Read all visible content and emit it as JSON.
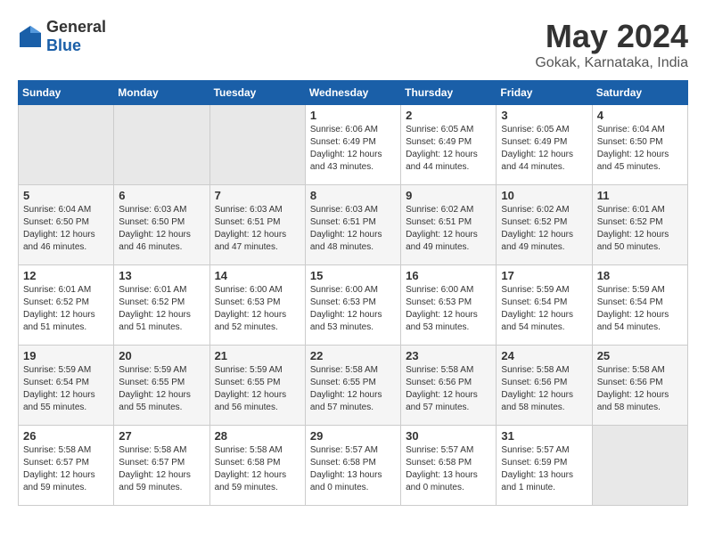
{
  "header": {
    "logo_general": "General",
    "logo_blue": "Blue",
    "month": "May 2024",
    "location": "Gokak, Karnataka, India"
  },
  "weekdays": [
    "Sunday",
    "Monday",
    "Tuesday",
    "Wednesday",
    "Thursday",
    "Friday",
    "Saturday"
  ],
  "weeks": [
    [
      {
        "day": "",
        "sunrise": "",
        "sunset": "",
        "daylight": "",
        "empty": true
      },
      {
        "day": "",
        "sunrise": "",
        "sunset": "",
        "daylight": "",
        "empty": true
      },
      {
        "day": "",
        "sunrise": "",
        "sunset": "",
        "daylight": "",
        "empty": true
      },
      {
        "day": "1",
        "sunrise": "Sunrise: 6:06 AM",
        "sunset": "Sunset: 6:49 PM",
        "daylight": "Daylight: 12 hours and 43 minutes."
      },
      {
        "day": "2",
        "sunrise": "Sunrise: 6:05 AM",
        "sunset": "Sunset: 6:49 PM",
        "daylight": "Daylight: 12 hours and 44 minutes."
      },
      {
        "day": "3",
        "sunrise": "Sunrise: 6:05 AM",
        "sunset": "Sunset: 6:49 PM",
        "daylight": "Daylight: 12 hours and 44 minutes."
      },
      {
        "day": "4",
        "sunrise": "Sunrise: 6:04 AM",
        "sunset": "Sunset: 6:50 PM",
        "daylight": "Daylight: 12 hours and 45 minutes."
      }
    ],
    [
      {
        "day": "5",
        "sunrise": "Sunrise: 6:04 AM",
        "sunset": "Sunset: 6:50 PM",
        "daylight": "Daylight: 12 hours and 46 minutes."
      },
      {
        "day": "6",
        "sunrise": "Sunrise: 6:03 AM",
        "sunset": "Sunset: 6:50 PM",
        "daylight": "Daylight: 12 hours and 46 minutes."
      },
      {
        "day": "7",
        "sunrise": "Sunrise: 6:03 AM",
        "sunset": "Sunset: 6:51 PM",
        "daylight": "Daylight: 12 hours and 47 minutes."
      },
      {
        "day": "8",
        "sunrise": "Sunrise: 6:03 AM",
        "sunset": "Sunset: 6:51 PM",
        "daylight": "Daylight: 12 hours and 48 minutes."
      },
      {
        "day": "9",
        "sunrise": "Sunrise: 6:02 AM",
        "sunset": "Sunset: 6:51 PM",
        "daylight": "Daylight: 12 hours and 49 minutes."
      },
      {
        "day": "10",
        "sunrise": "Sunrise: 6:02 AM",
        "sunset": "Sunset: 6:52 PM",
        "daylight": "Daylight: 12 hours and 49 minutes."
      },
      {
        "day": "11",
        "sunrise": "Sunrise: 6:01 AM",
        "sunset": "Sunset: 6:52 PM",
        "daylight": "Daylight: 12 hours and 50 minutes."
      }
    ],
    [
      {
        "day": "12",
        "sunrise": "Sunrise: 6:01 AM",
        "sunset": "Sunset: 6:52 PM",
        "daylight": "Daylight: 12 hours and 51 minutes."
      },
      {
        "day": "13",
        "sunrise": "Sunrise: 6:01 AM",
        "sunset": "Sunset: 6:52 PM",
        "daylight": "Daylight: 12 hours and 51 minutes."
      },
      {
        "day": "14",
        "sunrise": "Sunrise: 6:00 AM",
        "sunset": "Sunset: 6:53 PM",
        "daylight": "Daylight: 12 hours and 52 minutes."
      },
      {
        "day": "15",
        "sunrise": "Sunrise: 6:00 AM",
        "sunset": "Sunset: 6:53 PM",
        "daylight": "Daylight: 12 hours and 53 minutes."
      },
      {
        "day": "16",
        "sunrise": "Sunrise: 6:00 AM",
        "sunset": "Sunset: 6:53 PM",
        "daylight": "Daylight: 12 hours and 53 minutes."
      },
      {
        "day": "17",
        "sunrise": "Sunrise: 5:59 AM",
        "sunset": "Sunset: 6:54 PM",
        "daylight": "Daylight: 12 hours and 54 minutes."
      },
      {
        "day": "18",
        "sunrise": "Sunrise: 5:59 AM",
        "sunset": "Sunset: 6:54 PM",
        "daylight": "Daylight: 12 hours and 54 minutes."
      }
    ],
    [
      {
        "day": "19",
        "sunrise": "Sunrise: 5:59 AM",
        "sunset": "Sunset: 6:54 PM",
        "daylight": "Daylight: 12 hours and 55 minutes."
      },
      {
        "day": "20",
        "sunrise": "Sunrise: 5:59 AM",
        "sunset": "Sunset: 6:55 PM",
        "daylight": "Daylight: 12 hours and 55 minutes."
      },
      {
        "day": "21",
        "sunrise": "Sunrise: 5:59 AM",
        "sunset": "Sunset: 6:55 PM",
        "daylight": "Daylight: 12 hours and 56 minutes."
      },
      {
        "day": "22",
        "sunrise": "Sunrise: 5:58 AM",
        "sunset": "Sunset: 6:55 PM",
        "daylight": "Daylight: 12 hours and 57 minutes."
      },
      {
        "day": "23",
        "sunrise": "Sunrise: 5:58 AM",
        "sunset": "Sunset: 6:56 PM",
        "daylight": "Daylight: 12 hours and 57 minutes."
      },
      {
        "day": "24",
        "sunrise": "Sunrise: 5:58 AM",
        "sunset": "Sunset: 6:56 PM",
        "daylight": "Daylight: 12 hours and 58 minutes."
      },
      {
        "day": "25",
        "sunrise": "Sunrise: 5:58 AM",
        "sunset": "Sunset: 6:56 PM",
        "daylight": "Daylight: 12 hours and 58 minutes."
      }
    ],
    [
      {
        "day": "26",
        "sunrise": "Sunrise: 5:58 AM",
        "sunset": "Sunset: 6:57 PM",
        "daylight": "Daylight: 12 hours and 59 minutes."
      },
      {
        "day": "27",
        "sunrise": "Sunrise: 5:58 AM",
        "sunset": "Sunset: 6:57 PM",
        "daylight": "Daylight: 12 hours and 59 minutes."
      },
      {
        "day": "28",
        "sunrise": "Sunrise: 5:58 AM",
        "sunset": "Sunset: 6:58 PM",
        "daylight": "Daylight: 12 hours and 59 minutes."
      },
      {
        "day": "29",
        "sunrise": "Sunrise: 5:57 AM",
        "sunset": "Sunset: 6:58 PM",
        "daylight": "Daylight: 13 hours and 0 minutes."
      },
      {
        "day": "30",
        "sunrise": "Sunrise: 5:57 AM",
        "sunset": "Sunset: 6:58 PM",
        "daylight": "Daylight: 13 hours and 0 minutes."
      },
      {
        "day": "31",
        "sunrise": "Sunrise: 5:57 AM",
        "sunset": "Sunset: 6:59 PM",
        "daylight": "Daylight: 13 hours and 1 minute."
      },
      {
        "day": "",
        "sunrise": "",
        "sunset": "",
        "daylight": "",
        "empty": true
      }
    ]
  ]
}
